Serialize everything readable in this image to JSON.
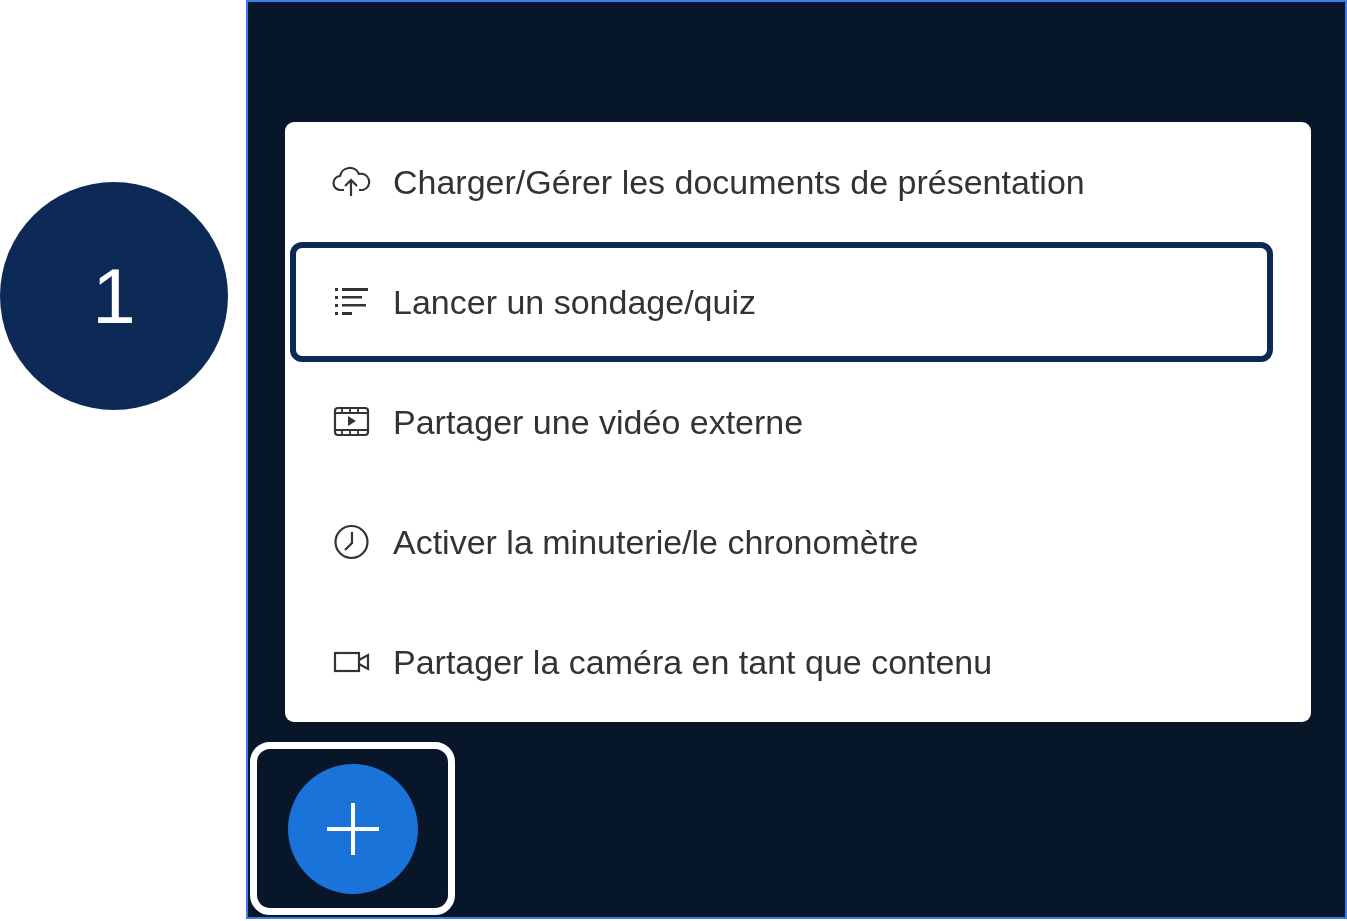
{
  "step_badge": "1",
  "menu": {
    "items": [
      {
        "kind": "upload",
        "label": "Charger/Gérer les documents de présentation",
        "highlighted": false
      },
      {
        "kind": "poll",
        "label": "Lancer un sondage/quiz",
        "highlighted": true
      },
      {
        "kind": "video",
        "label": "Partager une vidéo externe",
        "highlighted": false
      },
      {
        "kind": "timer",
        "label": "Activer la minuterie/le chronomètre",
        "highlighted": false
      },
      {
        "kind": "camera",
        "label": "Partager la caméra en tant que contenu",
        "highlighted": false
      }
    ]
  },
  "fab": {
    "highlighted": true
  }
}
